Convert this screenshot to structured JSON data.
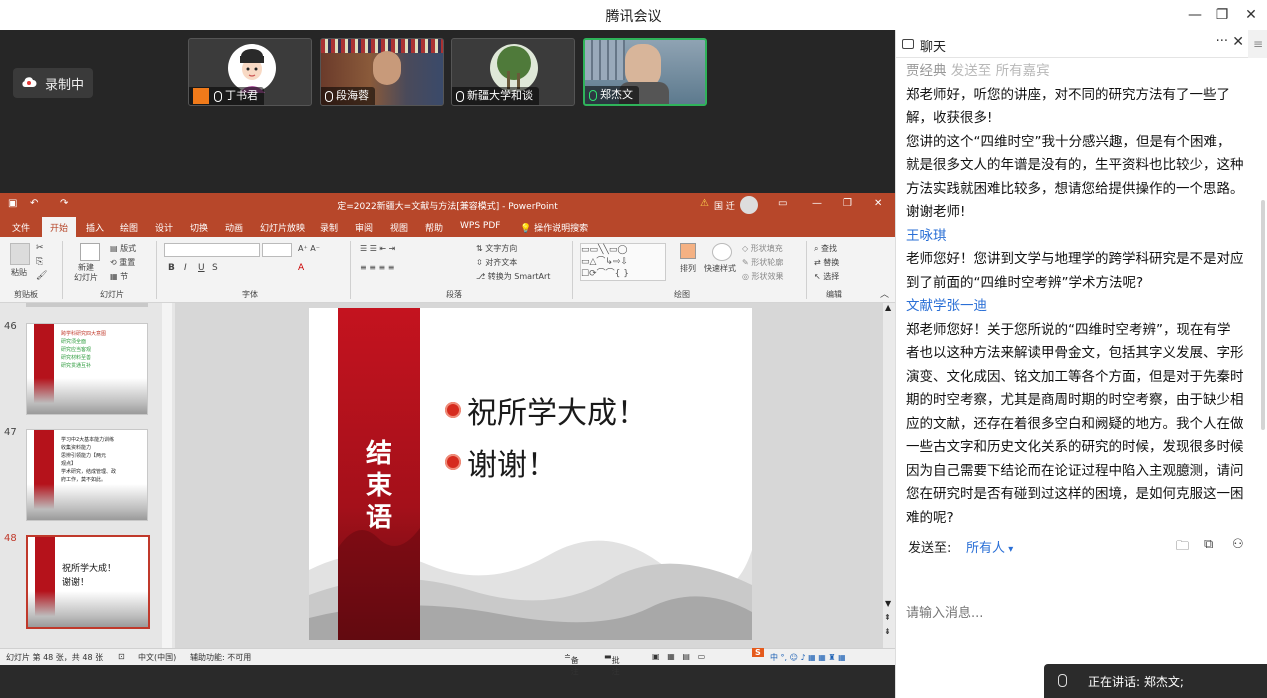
{
  "window": {
    "title": "腾讯会议",
    "minimize": "—",
    "maximize": "❐",
    "close": "✕"
  },
  "recording": {
    "label": "录制中"
  },
  "participants": [
    {
      "name": "丁书君",
      "avatar": "cartoon-avatar"
    },
    {
      "name": "段海蓉",
      "avatar": "video"
    },
    {
      "name": "新疆大学和谈",
      "avatar": "tree-photo"
    },
    {
      "name": "郑杰文",
      "avatar": "video",
      "active": true
    }
  ],
  "ppt": {
    "title": "定=2022新疆大=文献与方法[兼容模式] - PowerPoint",
    "user": "国 迁",
    "tabs": [
      "文件",
      "开始",
      "插入",
      "绘图",
      "设计",
      "切换",
      "动画",
      "幻灯片放映",
      "录制",
      "审阅",
      "视图",
      "帮助",
      "WPS PDF",
      "操作说明搜索"
    ],
    "selected_tab": "开始",
    "ribbon_groups": [
      "剪贴板",
      "幻灯片",
      "字体",
      "段落",
      "绘图",
      "编辑"
    ],
    "ribbon_items": {
      "paste": "粘贴",
      "new_slide": "新建\n幻灯片",
      "layout": "版式",
      "reset": "重置",
      "section": "节",
      "text_dir": "文字方向",
      "align_text": "对齐文本",
      "smartart": "转换为 SmartArt",
      "arrange": "排列",
      "quick_style": "快速样式",
      "shape_fill": "形状填充",
      "shape_outline": "形状轮廓",
      "shape_effect": "形状效果",
      "find": "查找",
      "replace": "替换",
      "select": "选择"
    },
    "thumbnails": [
      {
        "num": "46",
        "bar": "五、跨学科研究论方法研究",
        "lines": [
          "跨学科研究四大意图",
          "研究须全面",
          "研究应当客观",
          "研究材料至善",
          "研究贯通互补"
        ]
      },
      {
        "num": "47",
        "bar": "结束语",
        "lines": [
          "学习中2大基本能力训练",
          "收集资料能力",
          "思辨引领能力【两元",
          "观点】",
          "学术研究，结成管理、政",
          "府工作，莫不如此。"
        ]
      },
      {
        "num": "48",
        "bar": "结束语",
        "lines": [
          "祝所学大成！",
          "谢谢！"
        ],
        "selected": true
      }
    ],
    "slide": {
      "vertical_title": "结束语",
      "lines": [
        "祝所学大成！",
        "谢谢！"
      ]
    },
    "status": {
      "slide_info": "幻灯片 第 48 张，共 48 张",
      "language": "中文(中国)",
      "accessibility": "辅助功能: 不可用",
      "notes": "备注",
      "comments": "批注"
    }
  },
  "chat": {
    "title": "聊天",
    "more": "···",
    "close": "✕",
    "menu": "≡",
    "messages": [
      {
        "sender": "贾经典",
        "to_label": "发送至",
        "to": "所有嘉宾",
        "grey": true,
        "lines": [
          "郑老师好，听您的讲座，对不同的研究方法有了一些了",
          "解，收获很多!",
          "您讲的这个“四维时空”我十分感兴趣，但是有个困难，",
          "就是很多文人的年谱是没有的，生平资料也比较少，这种",
          "方法实践就困难比较多，想请您给提供操作的一个思路。",
          "谢谢老师!"
        ]
      },
      {
        "sender": "王咏琪",
        "lines": [
          "老师您好！您讲到文学与地理学的跨学科研究是不是对应",
          "到了前面的“四维时空考辨”学术方法呢?"
        ]
      },
      {
        "sender": "文献学张一迪",
        "lines": [
          "郑老师您好！关于您所说的“四维时空考辨”，现在有学",
          "者也以这种方法来解读甲骨金文，包括其字义发展、字形",
          "演变、文化成因、铭文加工等各个方面，但是对于先秦时",
          "期的时空考察，尤其是商周时期的时空考察，由于缺少相",
          "应的文献，还存在着很多空白和阙疑的地方。我个人在做",
          "一些古文字和历史文化关系的研究的时候，发现很多时候",
          "因为自己需要下结论而在论证过程中陷入主观臆测，请问",
          "您在研究时是否有碰到过这样的困境，是如何克服这一困",
          "难的呢?"
        ]
      }
    ],
    "send_label": "发送至:",
    "send_target": "所有人",
    "input_placeholder": "请输入消息..."
  },
  "speaking": {
    "label": "正在讲话: 郑杰文;"
  }
}
